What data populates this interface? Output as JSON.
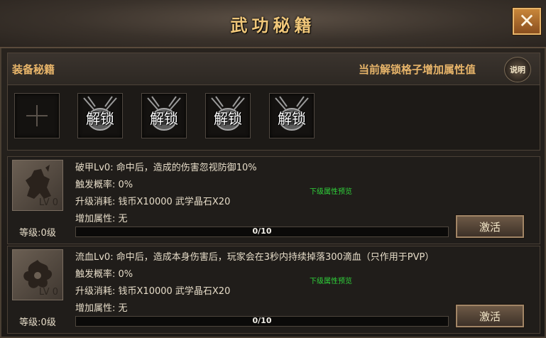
{
  "window": {
    "title": "武功秘籍",
    "close_icon": "close-icon"
  },
  "equip": {
    "title": "装备秘籍",
    "hint": "当前解锁格子增加属性值",
    "help_label": "说明",
    "empty_slot_icon": "plus-icon",
    "locked_slots": [
      {
        "label": "解锁",
        "icon": "chained-lock-icon"
      },
      {
        "label": "解锁",
        "icon": "chained-lock-icon"
      },
      {
        "label": "解锁",
        "icon": "chained-lock-icon"
      },
      {
        "label": "解锁",
        "icon": "chained-lock-icon"
      }
    ]
  },
  "skills": [
    {
      "portrait_icon": "warrior-silhouette-icon",
      "portrait_lv": "LV 0",
      "level": "等级:0级",
      "desc": "破甲Lv0: 命中后，造成的伤害忽视防御10%",
      "chance": "触发概率: 0%",
      "upgrade_cost": "升级消耗: 钱币X10000 武学晶石X20",
      "bonus": "增加属性: 无",
      "preview_link": "下级属性预览",
      "progress_text": "0/10",
      "progress": 0,
      "activate_label": "激活"
    },
    {
      "portrait_icon": "blood-splash-icon",
      "portrait_lv": "LV 0",
      "level": "等级:0级",
      "desc": "流血Lv0: 命中后，造成本身伤害后，玩家会在3秒内持续掉落300滴血（只作用于PVP）",
      "chance": "触发概率: 0%",
      "upgrade_cost": "升级消耗: 钱币X10000 武学晶石X20",
      "bonus": "增加属性: 无",
      "preview_link": "下级属性预览",
      "progress_text": "0/10",
      "progress": 0,
      "activate_label": "激活"
    }
  ],
  "colors": {
    "title_gold": "#f0c77a",
    "section_gold": "#e8b56a",
    "preview_green": "#2fd13a",
    "close_orange": "#c8863a"
  }
}
